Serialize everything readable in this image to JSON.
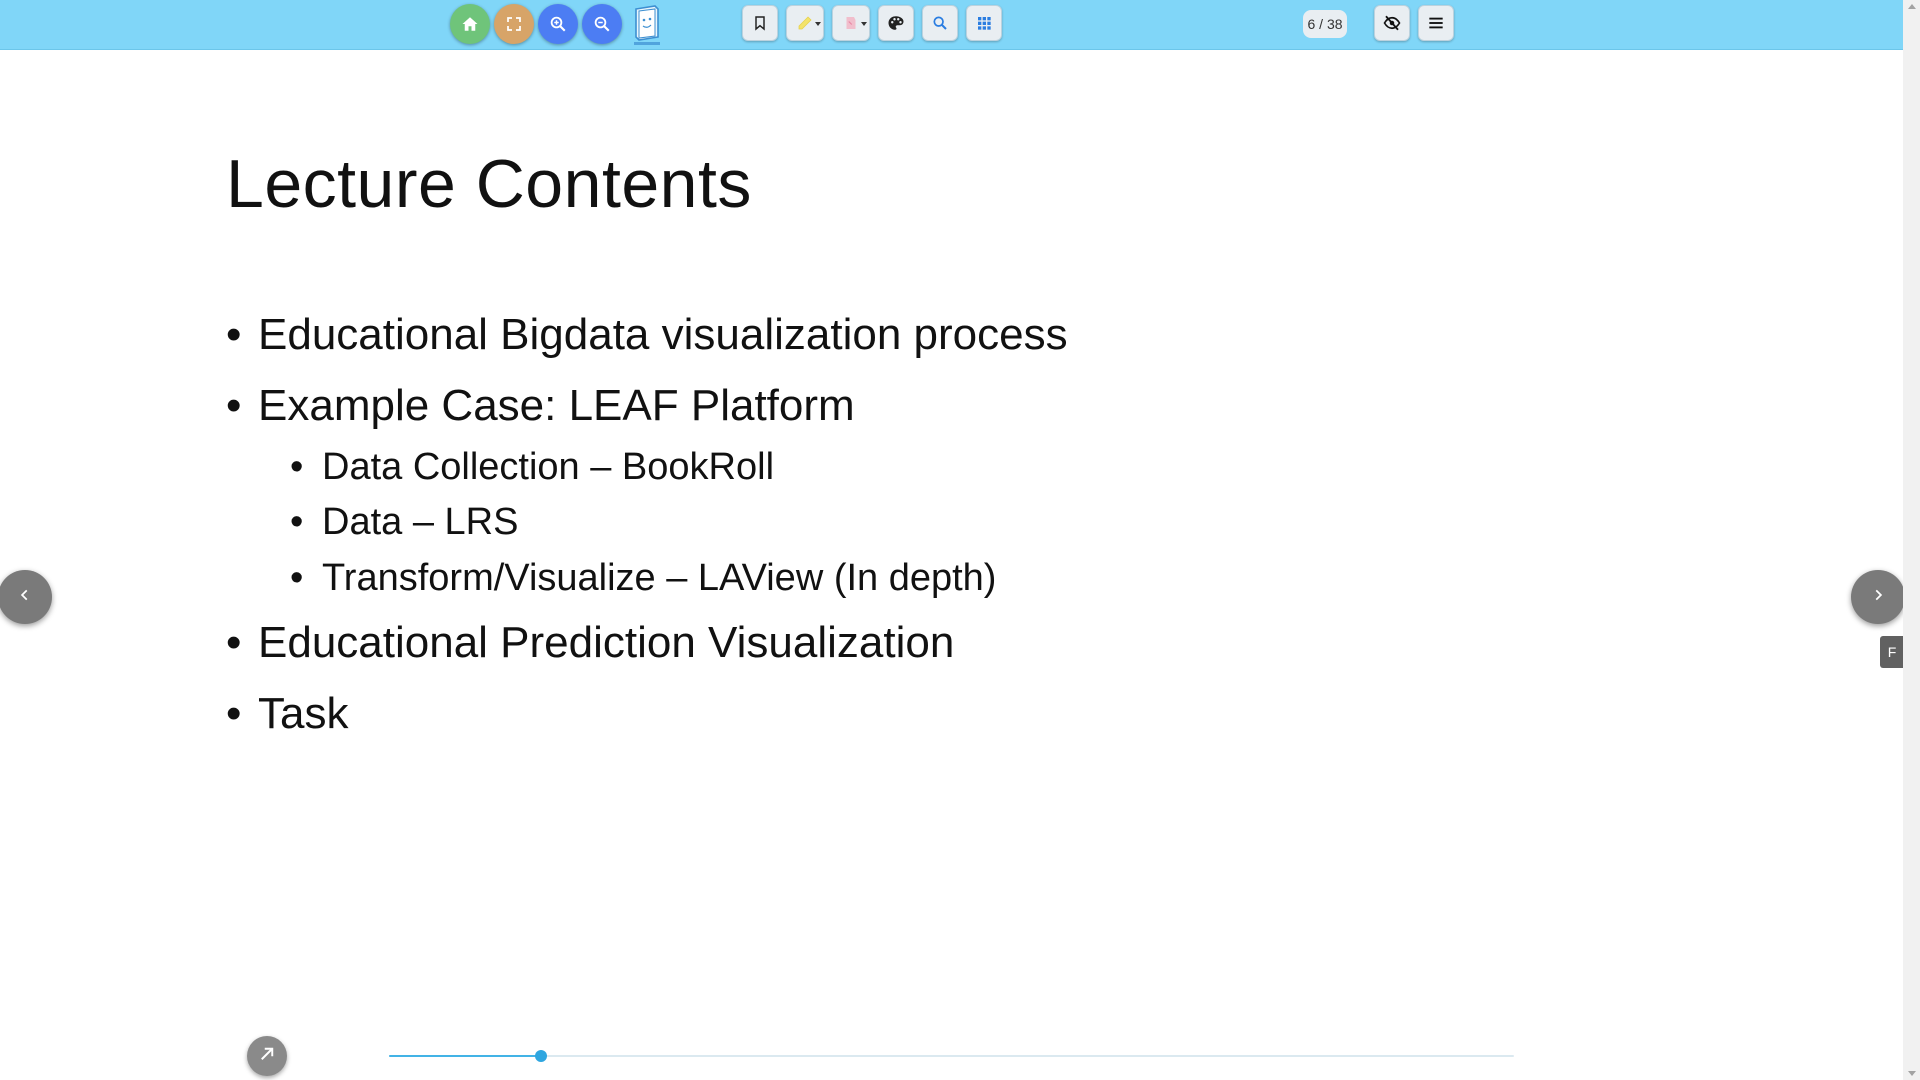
{
  "toolbar": {
    "home_color": "#6fc47a",
    "fullscreen_color": "#d7a468",
    "zoom_color": "#4c7df3",
    "highlight_color": "#f3e36b",
    "pen_color": "#f2b8c8",
    "page_counter": "6 / 38"
  },
  "slide": {
    "title": "Lecture Contents",
    "bullets": [
      "Educational Bigdata visualization process",
      "Example Case: LEAF Platform",
      "Educational Prediction Visualization",
      "Task"
    ],
    "sub_bullets": [
      "Data Collection – BookRoll",
      "Data – LRS",
      "Transform/Visualize – LAView (In depth)"
    ],
    "bullet_symbol": "•"
  },
  "side_tab": {
    "label": "F"
  },
  "page_slider": {
    "current_page": 6,
    "total_pages": 38,
    "progress_fraction": 0.135
  }
}
